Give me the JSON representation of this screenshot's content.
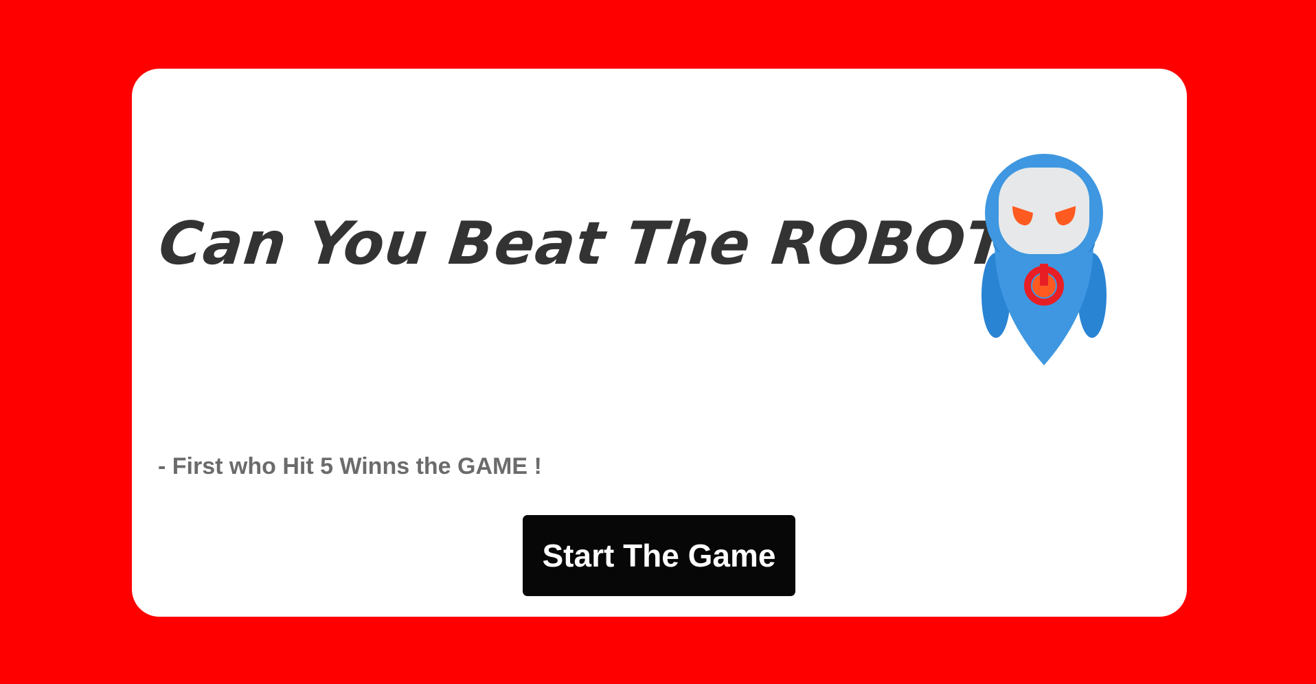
{
  "game": {
    "title": "Can You Beat The ROBOT !",
    "rule": "- First who Hit 5 Winns the GAME !",
    "start_button_label": "Start The Game"
  },
  "colors": {
    "background": "#ff0000",
    "card": "#ffffff",
    "title_text": "#333333",
    "rule_text": "#6b6b6b",
    "button_bg": "#070707",
    "button_text": "#ffffff",
    "robot_body": "#3e97e0",
    "robot_dark": "#2a84d4",
    "robot_face": "#e6e8ea",
    "robot_eyes": "#ff5a1f",
    "power_red": "#e81e25"
  },
  "icons": {
    "robot": "robot-icon",
    "power": "power-icon"
  }
}
